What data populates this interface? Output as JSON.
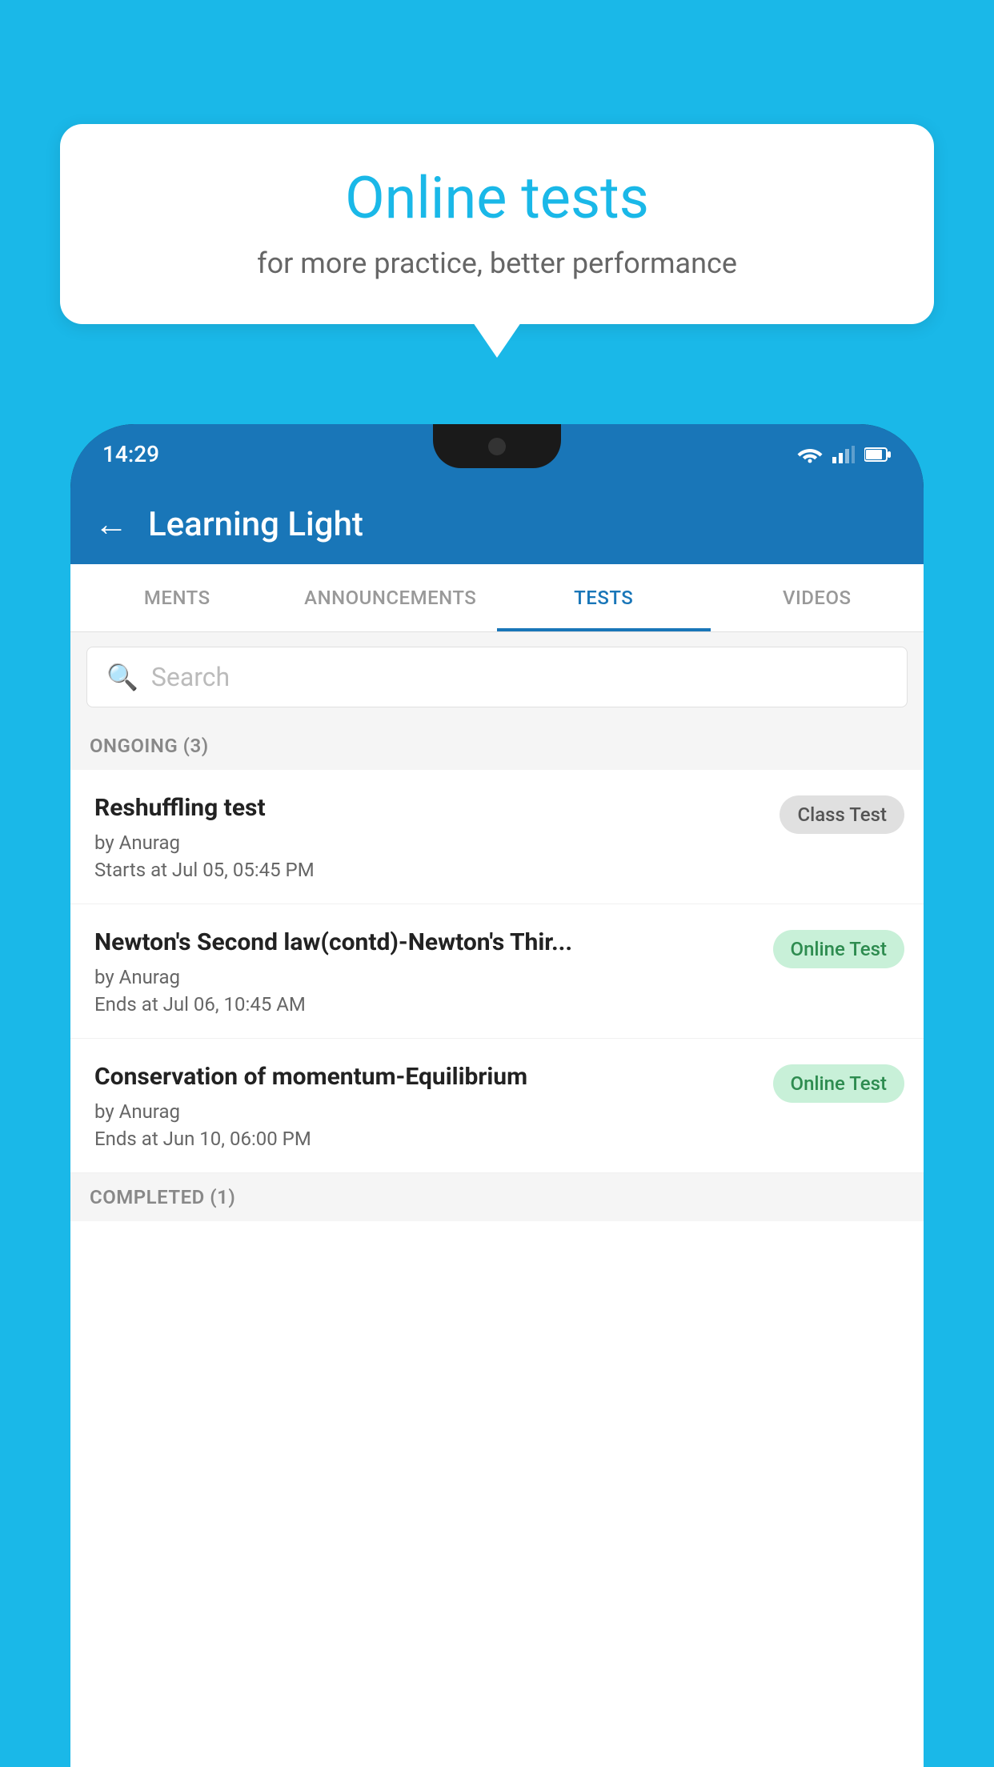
{
  "background": {
    "color": "#1ab8e8"
  },
  "speech_bubble": {
    "title": "Online tests",
    "subtitle": "for more practice, better performance"
  },
  "phone": {
    "status_bar": {
      "time": "14:29",
      "icons": [
        "wifi",
        "signal",
        "battery"
      ]
    },
    "app_bar": {
      "back_label": "←",
      "title": "Learning Light"
    },
    "tabs": [
      {
        "label": "MENTS",
        "active": false
      },
      {
        "label": "ANNOUNCEMENTS",
        "active": false
      },
      {
        "label": "TESTS",
        "active": true
      },
      {
        "label": "VIDEOS",
        "active": false
      }
    ],
    "search": {
      "placeholder": "Search"
    },
    "sections": [
      {
        "label": "ONGOING (3)",
        "items": [
          {
            "name": "Reshuffling test",
            "by": "by Anurag",
            "time": "Starts at  Jul 05, 05:45 PM",
            "badge": "Class Test",
            "badge_type": "class"
          },
          {
            "name": "Newton's Second law(contd)-Newton's Thir...",
            "by": "by Anurag",
            "time": "Ends at  Jul 06, 10:45 AM",
            "badge": "Online Test",
            "badge_type": "online"
          },
          {
            "name": "Conservation of momentum-Equilibrium",
            "by": "by Anurag",
            "time": "Ends at  Jun 10, 06:00 PM",
            "badge": "Online Test",
            "badge_type": "online"
          }
        ]
      },
      {
        "label": "COMPLETED (1)",
        "items": []
      }
    ]
  }
}
